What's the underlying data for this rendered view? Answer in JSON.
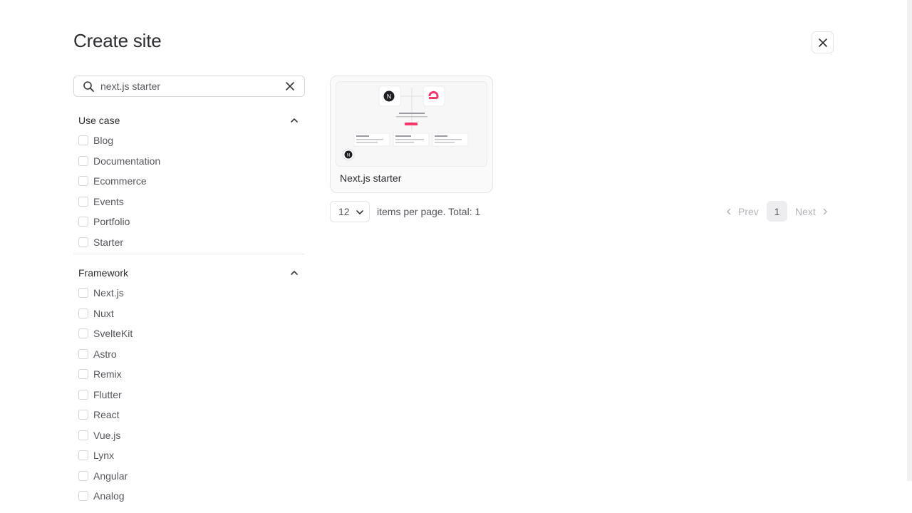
{
  "header": {
    "title": "Create site"
  },
  "search": {
    "value": "next.js starter",
    "placeholder": "Search"
  },
  "filters": {
    "use_case": {
      "title": "Use case",
      "options": [
        "Blog",
        "Documentation",
        "Ecommerce",
        "Events",
        "Portfolio",
        "Starter"
      ]
    },
    "framework": {
      "title": "Framework",
      "options": [
        "Next.js",
        "Nuxt",
        "SvelteKit",
        "Astro",
        "Remix",
        "Flutter",
        "React",
        "Vue.js",
        "Lynx",
        "Angular",
        "Analog"
      ]
    }
  },
  "results": {
    "cards": [
      {
        "title": "Next.js starter"
      }
    ]
  },
  "pagination": {
    "per_page": "12",
    "per_page_text": "items per page. Total: 1",
    "prev_label": "Prev",
    "next_label": "Next",
    "current_page": "1"
  },
  "colors": {
    "accent": "#fd366e",
    "text": "#2d2d31",
    "muted": "#56565c"
  }
}
